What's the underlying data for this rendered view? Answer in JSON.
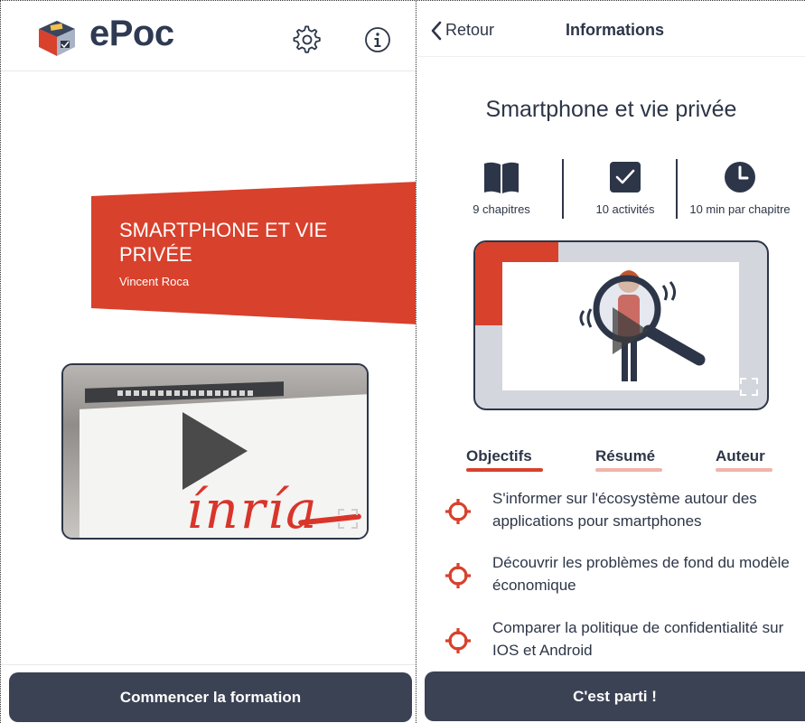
{
  "left": {
    "app_name": "ePoc",
    "icons": {
      "logo": "epoc-cube-logo",
      "settings": "gear-icon",
      "info": "info-circle-icon"
    },
    "banner": {
      "title": "SMARTPHONE ET VIE PRIVÉE",
      "author": "Vincent Roca"
    },
    "video": {
      "brand_text": "ínría",
      "play": "play-icon",
      "expand": "fullscreen-icon"
    },
    "start_button": "Commencer la formation"
  },
  "right": {
    "back_label": "Retour",
    "nav_title": "Informations",
    "course_title": "Smartphone et vie privée",
    "stats": {
      "chapters": "9 chapitres",
      "activities": "10 activités",
      "duration": "10 min par chapitre"
    },
    "tabs": [
      "Objectifs",
      "Résumé",
      "Auteur"
    ],
    "active_tab": "Objectifs",
    "objectives": [
      "S'informer sur l'écosystème autour des applications pour smartphones",
      "Découvrir les problèmes de fond du modèle économique",
      "Comparer la politique de confidentialité sur IOS et Android"
    ],
    "go_button": "C'est parti !"
  },
  "colors": {
    "brand_red": "#d8412c",
    "dark_navy": "#3b4254",
    "text": "#2d3648",
    "tab_underline_active": "#d8412c",
    "tab_underline_inactive": "#f0b3ab"
  }
}
